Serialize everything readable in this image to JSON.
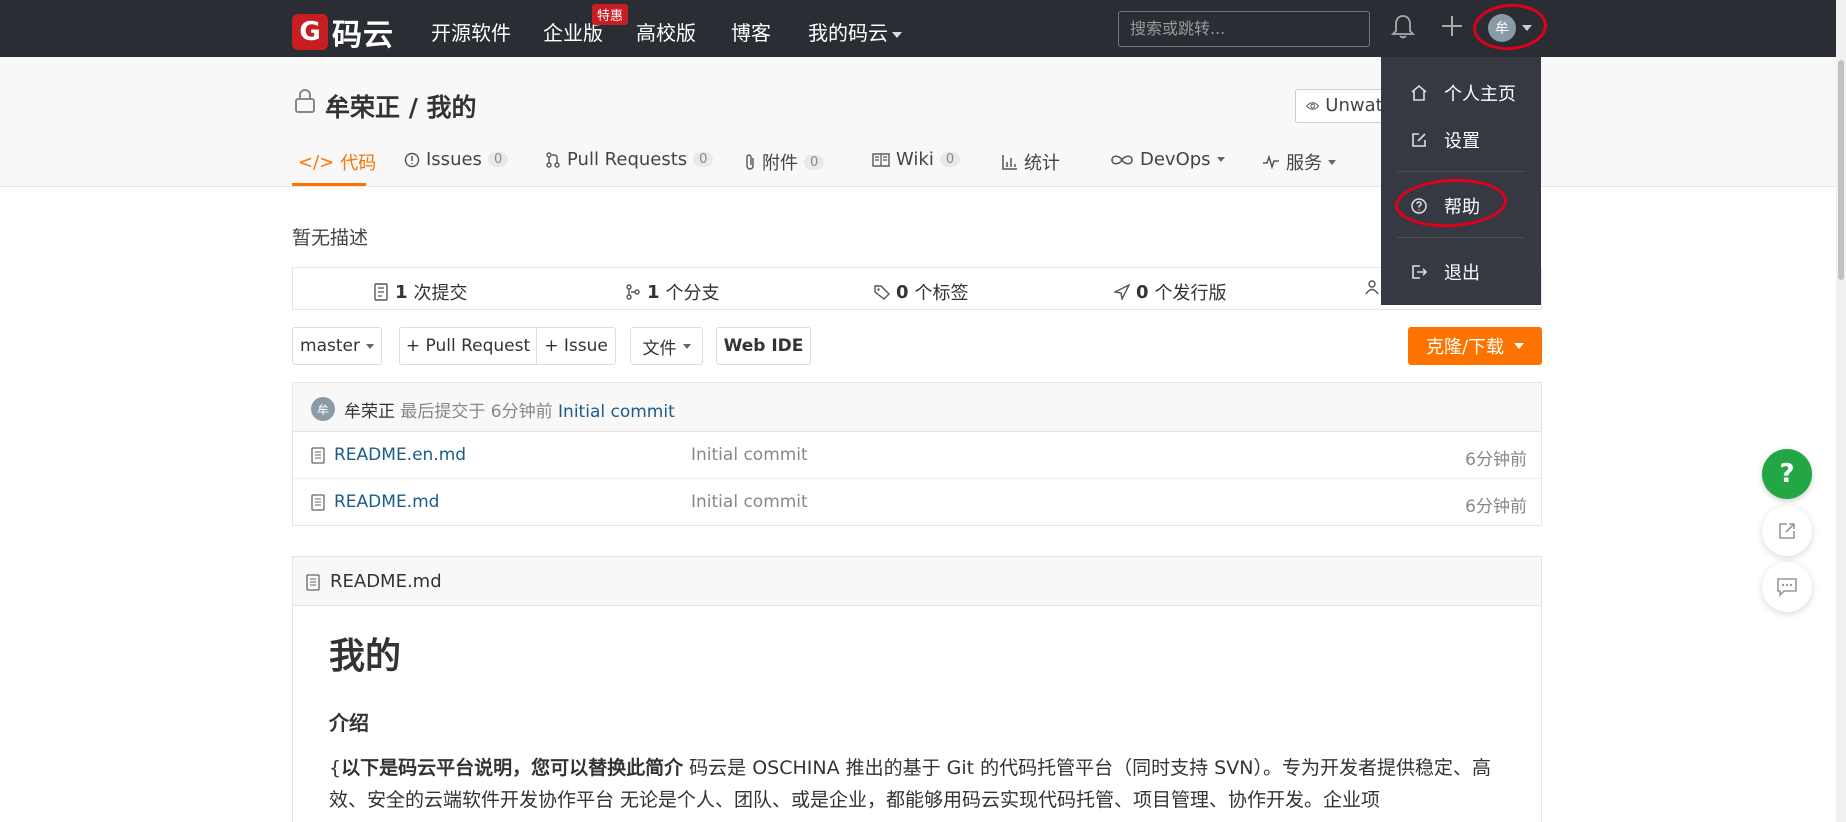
{
  "navbar": {
    "logo_mark": "G",
    "logo_text": "码云",
    "items": [
      "开源软件",
      "企业版",
      "高校版",
      "博客",
      "我的码云"
    ],
    "special_badge": "特惠",
    "search_placeholder": "搜索或跳转...",
    "avatar_initial": "牟"
  },
  "project": {
    "title": "牟荣正 / 我的",
    "unwatch_label": "Unwatch",
    "tabs": [
      {
        "label": "代码"
      },
      {
        "label": "Issues",
        "count": "0"
      },
      {
        "label": "Pull Requests",
        "count": "0"
      },
      {
        "label": "附件",
        "count": "0"
      },
      {
        "label": "Wiki",
        "count": "0"
      },
      {
        "label": "统计"
      },
      {
        "label": "DevOps"
      },
      {
        "label": "服务"
      }
    ]
  },
  "description": "暂无描述",
  "stats": {
    "commits": {
      "num": "1",
      "label": "次提交"
    },
    "branches": {
      "num": "1",
      "label": "个分支"
    },
    "tags": {
      "num": "0",
      "label": "个标签"
    },
    "releases": {
      "num": "0",
      "label": "个发行版"
    }
  },
  "toolbar": {
    "branch": "master",
    "pull_request": "+ Pull Request",
    "issue": "+ Issue",
    "files": "文件",
    "web_ide": "Web IDE",
    "clone": "克隆/下载"
  },
  "latest_commit": {
    "avatar": "牟",
    "author": "牟荣正",
    "meta": "最后提交于 6分钟前",
    "message": "Initial commit"
  },
  "files": [
    {
      "name": "README.en.md",
      "message": "Initial commit",
      "time": "6分钟前"
    },
    {
      "name": "README.md",
      "message": "Initial commit",
      "time": "6分钟前"
    }
  ],
  "readme": {
    "filename": "README.md",
    "h1": "我的",
    "h2": "介绍",
    "p_prefix": "{",
    "p_bold": "以下是码云平台说明，您可以替换此简介",
    "p_text": " 码云是 OSCHINA 推出的基于 Git 的代码托管平台（同时支持 SVN）。专为开发者提供稳定、高效、安全的云端软件开发协作平台 无论是个人、团队、或是企业，都能够用码云实现代码托管、项目管理、协作开发。企业项"
  },
  "dropdown": {
    "items": [
      "个人主页",
      "设置",
      "帮助",
      "退出"
    ]
  },
  "float": {
    "help": "?"
  },
  "colors": {
    "navbar": "#2a2d34",
    "accent": "#fe7300",
    "brand": "#c71d23",
    "help_green": "#23a644",
    "link": "#1a5c8a",
    "annotation_red": "#e0001b"
  }
}
